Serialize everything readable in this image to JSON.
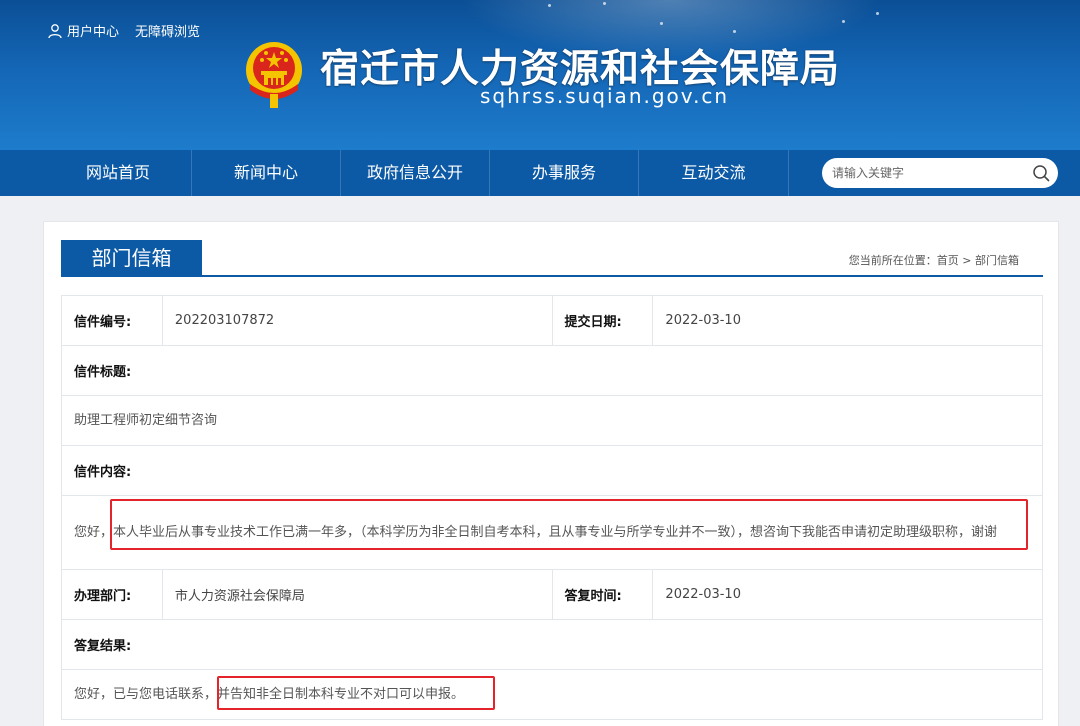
{
  "header": {
    "user_center": "用户中心",
    "accessibility": "无障碍浏览",
    "site_title": "宿迁市人力资源和社会保障局",
    "domain": "sqhrss.suqian.gov.cn"
  },
  "nav": {
    "items": [
      "网站首页",
      "新闻中心",
      "政府信息公开",
      "办事服务",
      "互动交流"
    ],
    "search_placeholder": "请输入关键字"
  },
  "section": {
    "title": "部门信箱",
    "breadcrumb_prefix": "您当前所在位置：",
    "breadcrumb_home": "首页",
    "breadcrumb_sep": ">",
    "breadcrumb_current": "部门信箱"
  },
  "letter": {
    "number_label": "信件编号:",
    "number": "202203107872",
    "submit_date_label": "提交日期:",
    "submit_date": "2022-03-10",
    "subject_label": "信件标题:",
    "subject": "助理工程师初定细节咨询",
    "content_label": "信件内容:",
    "content_prefix": "您好，",
    "content_body": "本人毕业后从事专业技术工作已满一年多，（本科学历为非全日制自考本科，且从事专业与所学专业并不一致），想咨询下我能否申请初定助理级职称，谢谢",
    "dept_label": "办理部门:",
    "dept": "市人力资源社会保障局",
    "reply_time_label": "答复时间:",
    "reply_time": "2022-03-10",
    "result_label": "答复结果:",
    "reply_prefix": "您好，已与您电话联系，",
    "reply_body": "并告知非全日制本科专业不对口可以申报。"
  },
  "colors": {
    "brand_blue": "#0c5aa6",
    "highlight_red": "#e3242b"
  }
}
